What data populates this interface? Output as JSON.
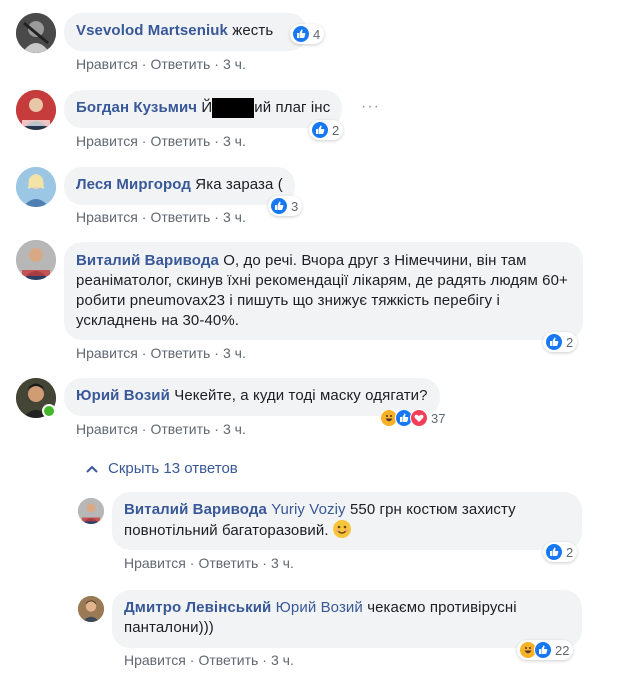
{
  "actions": {
    "like": "Нравится",
    "reply": "Ответить",
    "separator": "·"
  },
  "colors": {
    "author": "#385898",
    "bubble": "#f2f3f5",
    "like": "#1877f2",
    "love": "#f33e58",
    "haha": "#f7b125",
    "meta": "#606770",
    "online": "#42b72a"
  },
  "comments": [
    {
      "author": "Vsevolod Martseniuk",
      "text": "жесть",
      "time": "3 ч.",
      "reactions": [
        "like"
      ],
      "count": "4"
    },
    {
      "author": "Богдан Кузьмич",
      "text_before": "Й",
      "text_after": "ий плаг інс",
      "redacted": true,
      "more": "···",
      "time": "3 ч.",
      "reactions": [
        "like"
      ],
      "count": "2"
    },
    {
      "author": "Леся Миргород",
      "text": "Яка зараза (",
      "time": "3 ч.",
      "reactions": [
        "like"
      ],
      "count": "3"
    },
    {
      "author": "Виталий Варивода",
      "text": "О, до речі. Вчора друг з Німеччини, він там реаніматолог, скинув їхні рекомендації лікарям, де радять людям 60+ робити pneumovax23 і пишуть що знижує тяжкість перебігу і ускладнень на 30-40%.",
      "time": "3 ч.",
      "reactions": [
        "like"
      ],
      "count": "2"
    },
    {
      "author": "Юрий Возий",
      "text": "Чекейте, а куди тоді маску одягати?",
      "time": "3 ч.",
      "reactions": [
        "haha",
        "like",
        "love"
      ],
      "count": "37",
      "online": true
    }
  ],
  "hide_replies": {
    "label": "Скрыть 13 ответов",
    "icon": "chevron-up-icon"
  },
  "replies": [
    {
      "author": "Виталий Варивода",
      "mention": "Yuriy Voziy",
      "text": "550 грн костюм захисту повнотільний багаторазовий.",
      "emoji": "smiling-face-icon",
      "time": "3 ч.",
      "reactions": [
        "like"
      ],
      "count": "2"
    },
    {
      "author": "Дмитро Левінський",
      "mention": "Юрий Возий",
      "text": "чекаємо противірусні панталони)))",
      "time": "3 ч.",
      "reactions": [
        "haha",
        "like"
      ],
      "count": "22"
    }
  ]
}
